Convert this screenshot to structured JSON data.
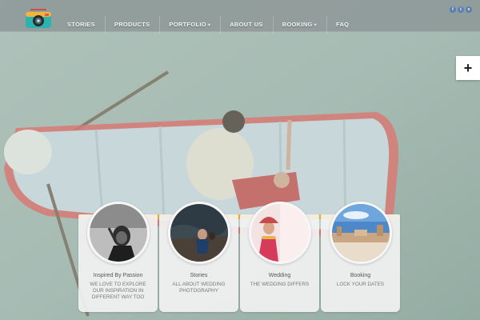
{
  "nav": {
    "items": [
      {
        "label": "STORIES",
        "has_dropdown": false
      },
      {
        "label": "PRODUCTS",
        "has_dropdown": false
      },
      {
        "label": "PORTFOLIO",
        "has_dropdown": true
      },
      {
        "label": "ABOUT US",
        "has_dropdown": false
      },
      {
        "label": "BOOKING",
        "has_dropdown": true
      },
      {
        "label": "FAQ",
        "has_dropdown": false
      }
    ],
    "logo_icon": "camera-icon",
    "caret_glyph": "▾"
  },
  "social": {
    "icons": [
      {
        "name": "facebook-icon",
        "glyph": "f"
      },
      {
        "name": "twitter-icon",
        "glyph": "t"
      },
      {
        "name": "vimeo-icon",
        "glyph": "v"
      }
    ]
  },
  "expand_button": {
    "glyph": "+",
    "icon": "plus-icon"
  },
  "cards": [
    {
      "title": "Inspired By Passion",
      "subtitle": "WE LOVE TO EXPLORE OUR INSPIRATION IN DIFFERENT WAY TOO",
      "image": "portrait-woman-bw"
    },
    {
      "title": "Stories",
      "subtitle": "ALL ABOUT WEDDING PHOTOGRAPHY",
      "image": "couple-rocks"
    },
    {
      "title": "Wedding",
      "subtitle": "THE WEDDING DIFFERS",
      "image": "bride-red"
    },
    {
      "title": "Booking",
      "subtitle": "LOCK YOUR DATES",
      "image": "palace-lake"
    }
  ],
  "colors": {
    "accent": "#f3b23a",
    "topbar": "#8c9696",
    "water": "#8fa9a2",
    "boat_trim": "#e0504a",
    "social": "#5b7fb0"
  }
}
